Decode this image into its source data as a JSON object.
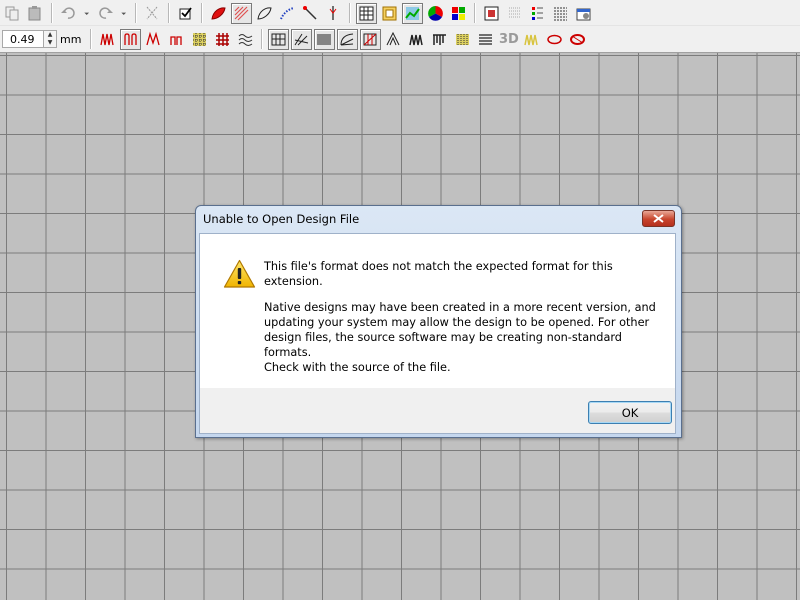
{
  "toolbar_top": {
    "buttons": [
      {
        "icon": "copy-icon"
      },
      {
        "icon": "paste-icon"
      },
      {
        "icon": "undo-icon"
      },
      {
        "icon": "undo-dropdown-icon"
      },
      {
        "icon": "redo-icon"
      },
      {
        "icon": "redo-dropdown-icon"
      },
      {
        "icon": "snap-icon"
      },
      {
        "icon": "checkbox-icon"
      },
      {
        "icon": "fill-shape-icon"
      },
      {
        "icon": "fill-pattern-icon"
      },
      {
        "icon": "outline-shape-icon"
      },
      {
        "icon": "dotted-outline-icon"
      },
      {
        "icon": "needle-icon"
      },
      {
        "icon": "needle-point-icon"
      },
      {
        "icon": "grid-icon"
      },
      {
        "icon": "hoop-icon"
      },
      {
        "icon": "chart-icon"
      },
      {
        "icon": "color-wheel-icon"
      },
      {
        "icon": "palette-icon"
      },
      {
        "icon": "preview-icon"
      },
      {
        "icon": "dots-grid-icon"
      },
      {
        "icon": "color-list-icon"
      },
      {
        "icon": "sequence-icon"
      },
      {
        "icon": "properties-icon"
      }
    ]
  },
  "toolbar_bottom": {
    "spacing_value": "0.49",
    "spacing_unit": "mm",
    "text_3d": "3D",
    "buttons": [
      {
        "icon": "zigzag-red-icon"
      },
      {
        "icon": "satin-red-icon"
      },
      {
        "icon": "wave-red-icon"
      },
      {
        "icon": "tatami-red-icon"
      },
      {
        "icon": "cross-fill-icon"
      },
      {
        "icon": "grid-fill-icon"
      },
      {
        "icon": "wave-fill-icon"
      },
      {
        "icon": "stitch-grid-icon"
      },
      {
        "icon": "stitch-diagonal-icon"
      },
      {
        "icon": "stitch-dense-icon"
      },
      {
        "icon": "stitch-curve-icon"
      },
      {
        "icon": "stitch-cross-icon"
      },
      {
        "icon": "stitch-peak-icon"
      },
      {
        "icon": "stitch-wave-icon"
      },
      {
        "icon": "stitch-comb-icon"
      },
      {
        "icon": "stitch-dots-icon"
      },
      {
        "icon": "stitch-lines-icon"
      },
      {
        "icon": "stitch-3d-icon"
      },
      {
        "icon": "stitch-zig-icon"
      },
      {
        "icon": "ellipse-outline-icon"
      },
      {
        "icon": "ellipse-red-icon"
      }
    ]
  },
  "dialog": {
    "title": "Unable to Open Design File",
    "message_line1": "This file's format does not match the expected format for this extension.",
    "message_line2": "Native designs may have been created in a more recent version, and\nupdating your system may allow the design to be opened.  For other\ndesign files, the source software may be creating non-standard formats.\n Check with the source of the file.",
    "ok_label": "OK"
  }
}
